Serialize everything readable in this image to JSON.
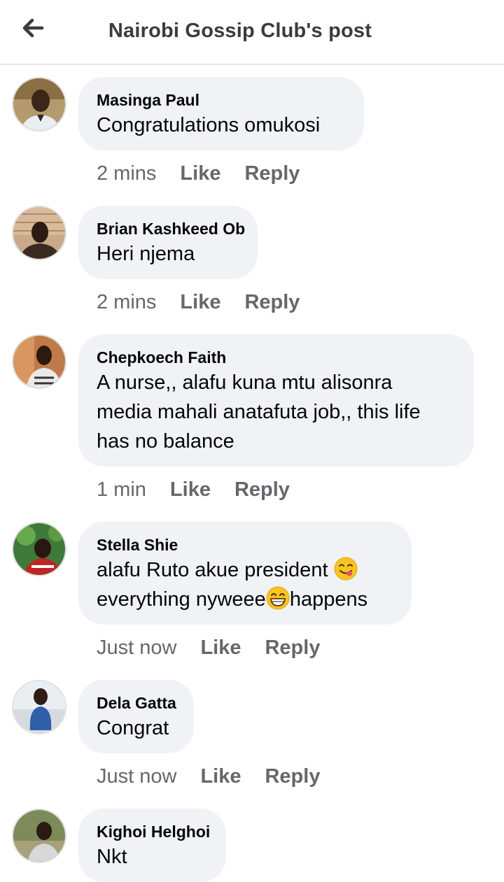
{
  "header": {
    "title": "Nairobi Gossip Club's post",
    "back_icon": "arrow-left-icon"
  },
  "comments": [
    {
      "author": "Masinga Paul",
      "lines": [
        "Congratulations omukosi"
      ],
      "time": "2 mins",
      "like": "Like",
      "reply": "Reply"
    },
    {
      "author": "Brian Kashkeed Ob",
      "lines": [
        "Heri njema"
      ],
      "time": "2 mins",
      "like": "Like",
      "reply": "Reply"
    },
    {
      "author": "Chepkoech Faith",
      "lines": [
        "A nurse,, alafu kuna mtu alisonra",
        "media mahali anatafuta job,, this life",
        "has no balance"
      ],
      "time": "1 min",
      "like": "Like",
      "reply": "Reply"
    },
    {
      "author": "Stella Shie",
      "lines": [
        "alafu Ruto akue president",
        "everything nyweee",
        "happens"
      ],
      "emojis": [
        "face-savoring-food-emoji",
        "grinning-face-emoji"
      ],
      "time": "Just now",
      "like": "Like",
      "reply": "Reply"
    },
    {
      "author": "Dela Gatta",
      "lines": [
        "Congrat"
      ],
      "time": "Just now",
      "like": "Like",
      "reply": "Reply"
    },
    {
      "author": "Kighoi Helghoi",
      "lines": [
        "Nkt"
      ]
    }
  ],
  "colors": {
    "bubble": "#f0f2f5",
    "meta_text": "#65676b",
    "title_text": "#3a3b3f"
  }
}
